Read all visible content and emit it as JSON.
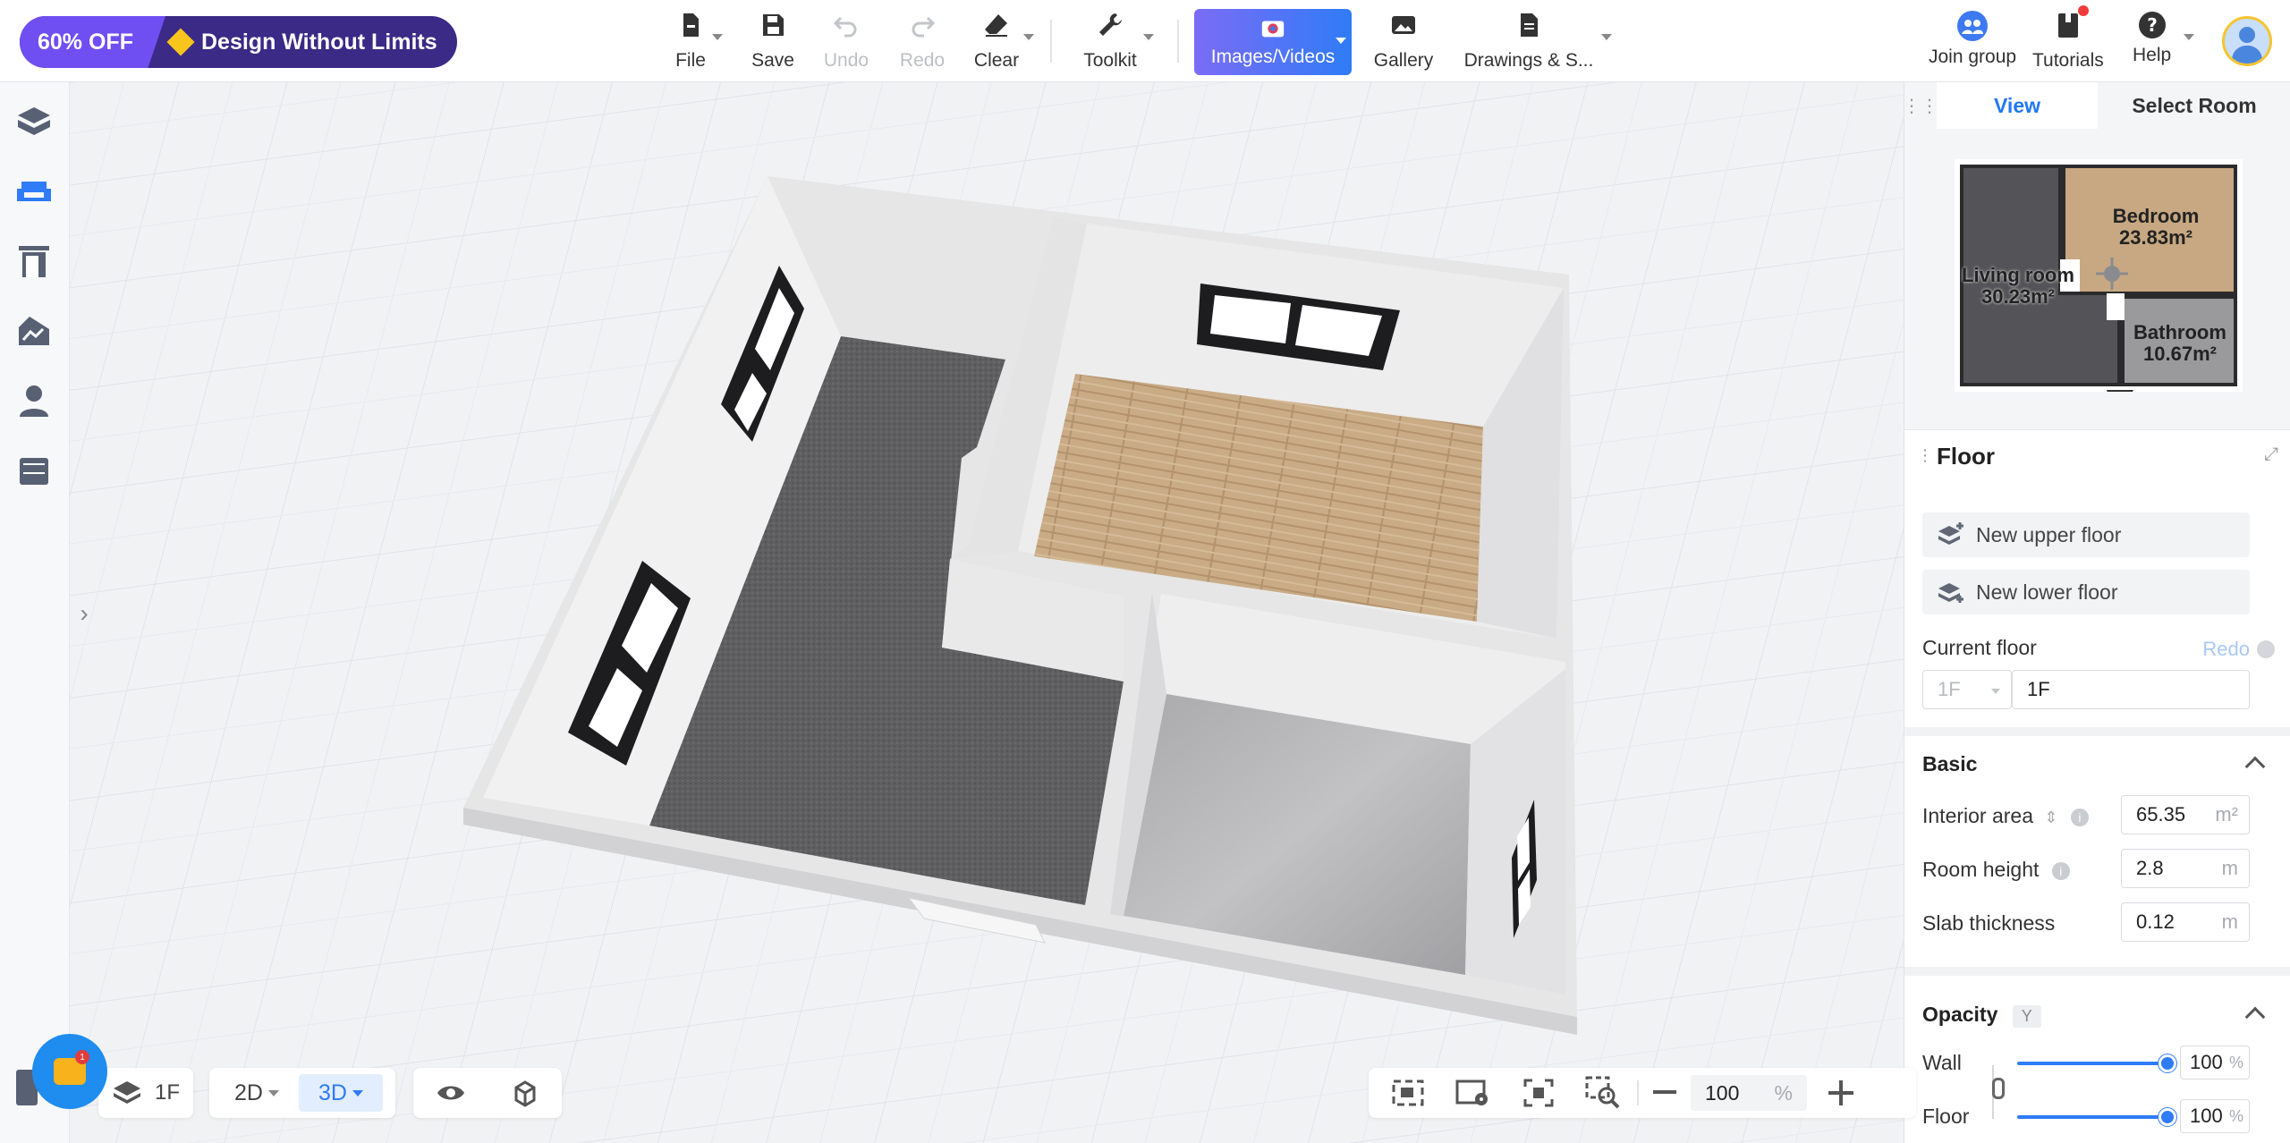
{
  "promo": {
    "discount": "60% OFF",
    "tagline": "Design Without Limits"
  },
  "toolbar": {
    "file": "File",
    "save": "Save",
    "undo": "Undo",
    "redo": "Redo",
    "clear": "Clear",
    "toolkit": "Toolkit",
    "images": "Images/Videos",
    "gallery": "Gallery",
    "drawings": "Drawings & S..."
  },
  "top_right": {
    "join": "Join group",
    "tutorials": "Tutorials",
    "help": "Help"
  },
  "left_rail": {
    "icons": [
      "build-icon",
      "furniture-icon",
      "door-window-icon",
      "terrain-icon",
      "person-icon",
      "cabinet-icon"
    ],
    "active_index": 1
  },
  "view_tabs": {
    "view": "View",
    "select_room": "Select Room"
  },
  "minimap": {
    "rooms": [
      {
        "name": "Bedroom",
        "area": "23.83m²"
      },
      {
        "name": "Living room",
        "area": "30.23m²"
      },
      {
        "name": "Bathroom",
        "area": "10.67m²"
      }
    ]
  },
  "floor_panel": {
    "title": "Floor",
    "new_upper": "New upper floor",
    "new_lower": "New lower floor",
    "current_floor_label": "Current floor",
    "redo": "Redo",
    "floor_select": "1F",
    "floor_name": "1F",
    "basic": "Basic",
    "interior_area_label": "Interior area",
    "interior_area": "65.35",
    "interior_area_unit": "m²",
    "room_height_label": "Room height",
    "room_height": "2.8",
    "room_height_unit": "m",
    "slab_label": "Slab thickness",
    "slab": "0.12",
    "slab_unit": "m",
    "opacity": "Opacity",
    "opacity_key": "Y",
    "wall_label": "Wall",
    "wall_opacity": "100",
    "floor_label": "Floor",
    "floor_opacity": "100",
    "percent": "%"
  },
  "bottom_left": {
    "floor": "1F",
    "mode_2d": "2D",
    "mode_3d": "3D",
    "chat_badge": "1"
  },
  "bottom_right": {
    "zoom": "100",
    "zoom_unit": "%"
  },
  "colors": {
    "accent": "#2f7cf6",
    "promo_bg": "#3b2a86",
    "promo_off": "#6f4ef2"
  }
}
